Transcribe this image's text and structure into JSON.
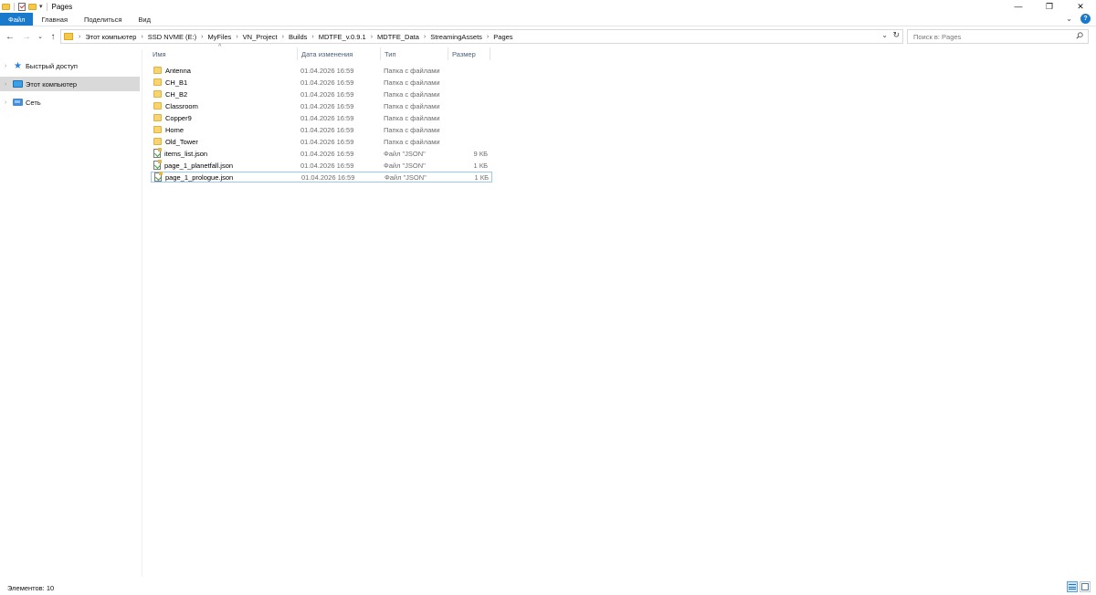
{
  "window": {
    "title": "Pages",
    "controls": {
      "minimize": "—",
      "restore": "❐",
      "close": "✕"
    }
  },
  "ribbon": {
    "tabs": [
      "Файл",
      "Главная",
      "Поделиться",
      "Вид"
    ],
    "accent_color": "#1979ca"
  },
  "address": {
    "breadcrumbs": [
      "Этот компьютер",
      "SSD NVME (E:)",
      "MyFiles",
      "VN_Project",
      "Builds",
      "MDTFE_v.0.9.1",
      "MDTFE_Data",
      "StreamingAssets",
      "Pages"
    ]
  },
  "search": {
    "placeholder": "Поиск в: Pages"
  },
  "sidebar": {
    "items": [
      {
        "label": "Быстрый доступ",
        "icon": "star-icon",
        "selected": false
      },
      {
        "label": "Этот компьютер",
        "icon": "computer-icon",
        "selected": true
      },
      {
        "label": "Сеть",
        "icon": "network-icon",
        "selected": false
      }
    ]
  },
  "columns": {
    "name": "Имя",
    "date": "Дата изменения",
    "type": "Тип",
    "size": "Размер"
  },
  "files": [
    {
      "name": "Antenna",
      "date": "01.04.2026 16:59",
      "type": "Папка с файлами",
      "size": "",
      "kind": "folder"
    },
    {
      "name": "CH_B1",
      "date": "01.04.2026 16:59",
      "type": "Папка с файлами",
      "size": "",
      "kind": "folder"
    },
    {
      "name": "CH_B2",
      "date": "01.04.2026 16:59",
      "type": "Папка с файлами",
      "size": "",
      "kind": "folder"
    },
    {
      "name": "Classroom",
      "date": "01.04.2026 16:59",
      "type": "Папка с файлами",
      "size": "",
      "kind": "folder"
    },
    {
      "name": "Copper9",
      "date": "01.04.2026 16:59",
      "type": "Папка с файлами",
      "size": "",
      "kind": "folder"
    },
    {
      "name": "Home",
      "date": "01.04.2026 16:59",
      "type": "Папка с файлами",
      "size": "",
      "kind": "folder"
    },
    {
      "name": "Old_Tower",
      "date": "01.04.2026 16:59",
      "type": "Папка с файлами",
      "size": "",
      "kind": "folder"
    },
    {
      "name": "items_list.json",
      "date": "01.04.2026 16:59",
      "type": "Файл \"JSON\"",
      "size": "9 КБ",
      "kind": "json"
    },
    {
      "name": "page_1_planetfall.json",
      "date": "01.04.2026 16:59",
      "type": "Файл \"JSON\"",
      "size": "1 КБ",
      "kind": "json"
    },
    {
      "name": "page_1_prologue.json",
      "date": "01.04.2026 16:59",
      "type": "Файл \"JSON\"",
      "size": "1 КБ",
      "kind": "json",
      "focused": true
    }
  ],
  "status": {
    "items_count": "Элементов: 10"
  }
}
